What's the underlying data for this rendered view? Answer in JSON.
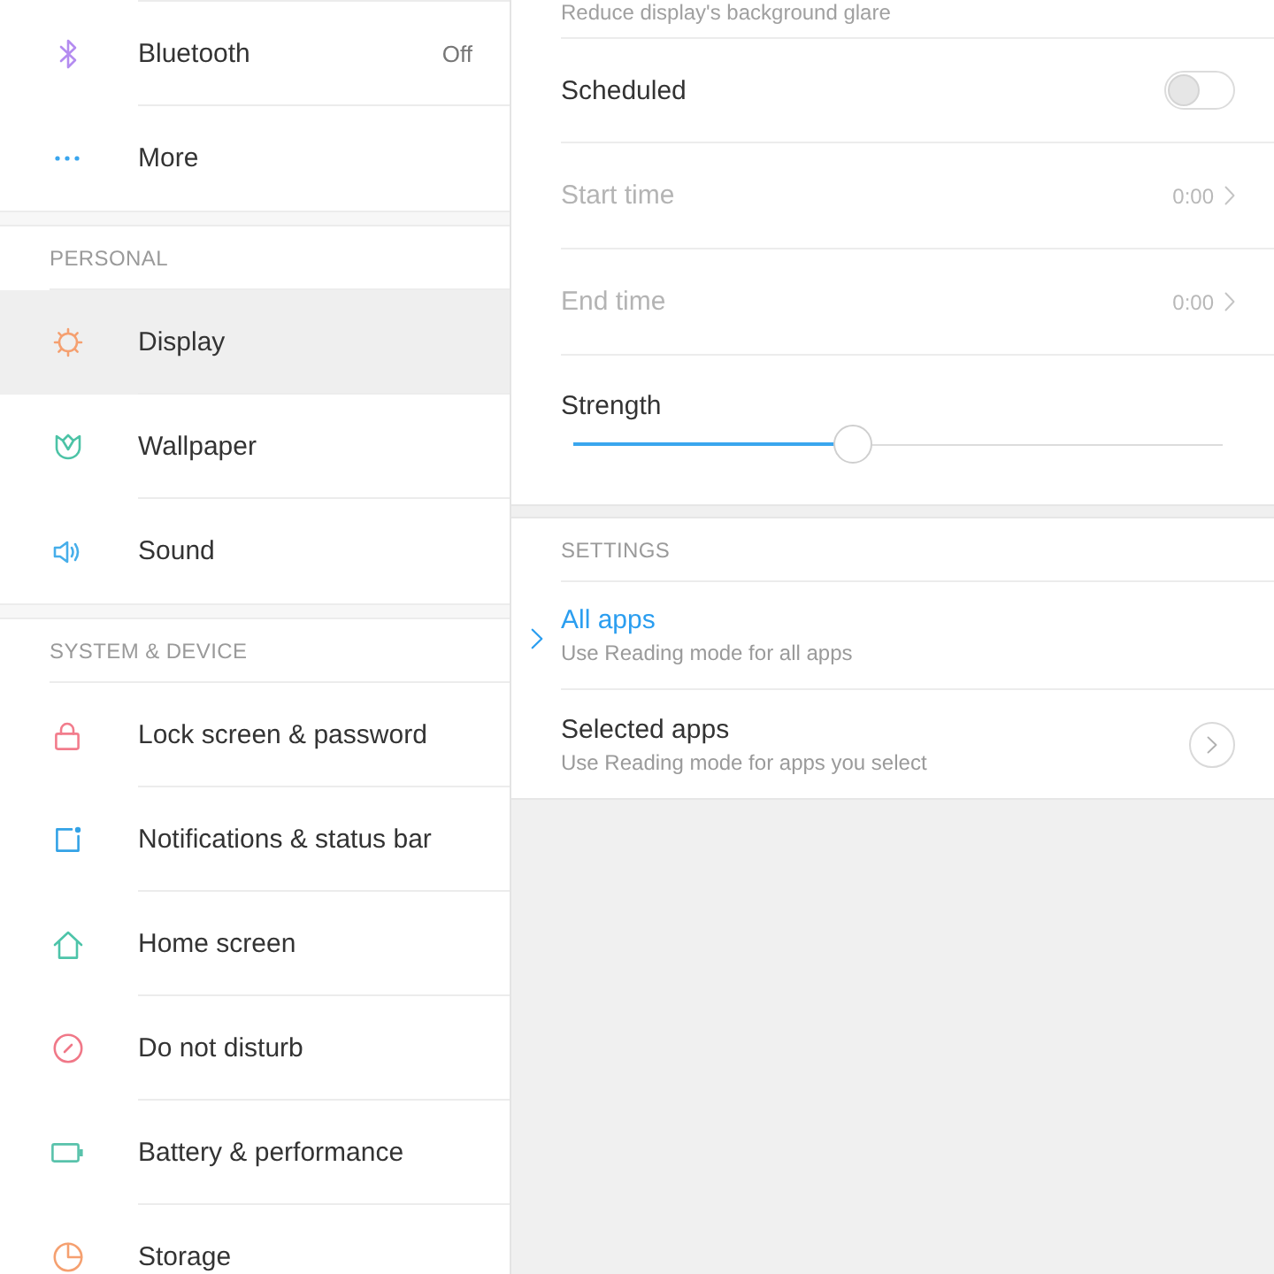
{
  "sidebar": {
    "sections": [
      {
        "items": [
          {
            "label": "Bluetooth",
            "value": "Off",
            "selected": false
          },
          {
            "label": "More",
            "selected": false
          }
        ]
      },
      {
        "header": "PERSONAL",
        "items": [
          {
            "label": "Display",
            "selected": true
          },
          {
            "label": "Wallpaper",
            "selected": false
          },
          {
            "label": "Sound",
            "selected": false
          }
        ]
      },
      {
        "header": "SYSTEM & DEVICE",
        "items": [
          {
            "label": "Lock screen & password",
            "selected": false
          },
          {
            "label": "Notifications & status bar",
            "selected": false
          },
          {
            "label": "Home screen",
            "selected": false
          },
          {
            "label": "Do not disturb",
            "selected": false
          },
          {
            "label": "Battery & performance",
            "selected": false
          },
          {
            "label": "Storage",
            "selected": false
          }
        ]
      }
    ]
  },
  "reading_mode": {
    "description": "Reduce display's background glare"
  },
  "schedule": {
    "label": "Scheduled",
    "on": false
  },
  "times": [
    {
      "label": "Start time",
      "value": "0:00",
      "disabled": true
    },
    {
      "label": "End time",
      "value": "0:00",
      "disabled": true
    }
  ],
  "strength": {
    "label": "Strength",
    "level": 0.43
  },
  "settings": {
    "header": "SETTINGS",
    "options": [
      {
        "title": "All apps",
        "subtitle": "Use Reading mode for all apps",
        "selected": true,
        "kind": "plain"
      },
      {
        "title": "Selected apps",
        "subtitle": "Use Reading mode for apps you select",
        "selected": false,
        "kind": "picker"
      }
    ]
  }
}
